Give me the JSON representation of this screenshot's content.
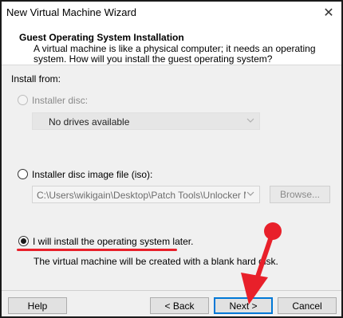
{
  "window": {
    "title": "New Virtual Machine Wizard",
    "close_glyph": "✕"
  },
  "header": {
    "title": "Guest Operating System Installation",
    "description": "A virtual machine is like a physical computer; it needs an operating system. How will you install the guest operating system?"
  },
  "install_from": {
    "label": "Install from:",
    "disc": {
      "label": "Installer disc:",
      "dropdown_value": "No drives available",
      "enabled": false
    },
    "iso": {
      "label": "Installer disc image file (iso):",
      "path": "C:\\Users\\wikigain\\Desktop\\Patch Tools\\Unlocker Master",
      "browse_label": "Browse..."
    },
    "later": {
      "label": "I will install the operating system later.",
      "note": "The virtual machine will be created with a blank hard disk.",
      "selected": true
    }
  },
  "footer": {
    "help": "Help",
    "back": "< Back",
    "next": "Next >",
    "cancel": "Cancel"
  },
  "annotation_color": "#e8202a"
}
